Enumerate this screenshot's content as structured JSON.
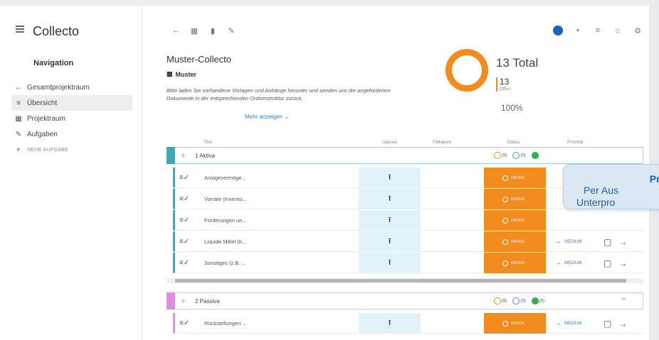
{
  "app": {
    "title": "Collecto"
  },
  "nav": {
    "heading": "Navigation",
    "items": [
      {
        "label": "Gesamtprojektraum",
        "icon": "arrow-left-icon"
      },
      {
        "label": "Übersicht",
        "icon": "list-check-icon"
      },
      {
        "label": "Projektraum",
        "icon": "grid-icon"
      },
      {
        "label": "Aufgaben",
        "icon": "edit-icon"
      },
      {
        "label": "NEUE AUFGABE",
        "icon": "plus-icon"
      }
    ]
  },
  "project": {
    "title": "Muster-Collecto",
    "tag": "Muster",
    "description": "Bitte laden Sie vorhandene Vorlagen und Anhänge herunter und senden uns die angeforderten Dokumente in der entsprechenden Ordnerstruktur zurück.",
    "more_label": "Mehr anzeigen ⌄"
  },
  "summary": {
    "total": "13 Total",
    "open_count": "13",
    "open_label": "Offen",
    "percent": "100%",
    "open_fraction": 1.0,
    "accent": "#f28c1f"
  },
  "table": {
    "headers": [
      "Titel",
      "Upload",
      "Fälligkeit",
      "Status",
      "Priorität"
    ],
    "groups": [
      {
        "name": "1 Aktiva",
        "color": "#3fa9b5",
        "counts": [
          "(5)",
          "(0)"
        ],
        "items": [
          {
            "title": "Anlagevermöge...",
            "status": "OFFEN",
            "priority": ""
          },
          {
            "title": "Vorräte (Inventu...",
            "status": "OFFEN",
            "priority": ""
          },
          {
            "title": "Forderungen un...",
            "status": "OFFEN",
            "priority": ""
          },
          {
            "title": "Liquide Mittel (K...",
            "status": "OFFEN",
            "priority": "MEDIUM"
          },
          {
            "title": "Sonstiges (z.B. ...",
            "status": "OFFEN",
            "priority": "MEDIUM"
          }
        ]
      },
      {
        "name": "2 Passiva",
        "color": "#e08ee0",
        "counts": [
          "(8)",
          "(0)",
          "(0)"
        ],
        "items": [
          {
            "title": "Rückstellungen ...",
            "status": "OFFEN",
            "priority": "MEDIUM"
          }
        ]
      }
    ]
  },
  "tooltip": {
    "title": "Proj",
    "line1": "Per Aus",
    "line2": "Unterpro"
  }
}
